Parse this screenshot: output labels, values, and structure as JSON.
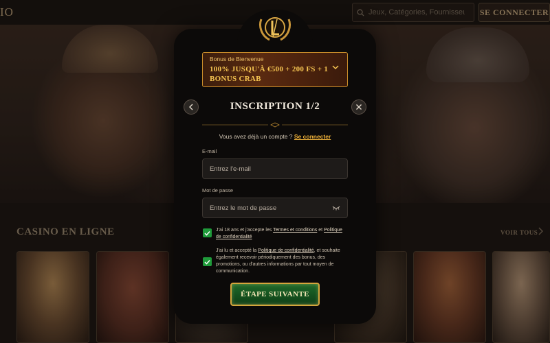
{
  "site": {
    "logo_text": "IO",
    "search": {
      "placeholder": "Jeux, Catégories, Fournisseurs"
    },
    "login_label": "SE CONNECTER",
    "section_title": "CASINO EN LIGNE",
    "see_all_label": "VOIR TOUS"
  },
  "modal": {
    "promo": {
      "label": "Bonus de Bienvenue",
      "offer": "100% JUSQU'À €500 + 200 FS + 1 BONUS CRAB"
    },
    "title": "INSCRIPTION 1/2",
    "have_account_text": "Vous avez déjà un compte ?",
    "login_link": "Se connecter",
    "email": {
      "label": "E-mail",
      "placeholder": "Entrez l'e-mail"
    },
    "password": {
      "label": "Mot de passe",
      "placeholder": "Entrez le mot de passe"
    },
    "consent_age": {
      "checked": true,
      "prefix": "J'ai 18 ans et j'accepte les",
      "terms_link": "Termes et conditions",
      "and": "et",
      "privacy_link": "Politique de confidentialité"
    },
    "consent_marketing": {
      "checked": true,
      "prefix": "J'ai lu et accepté la",
      "privacy_link": "Politique de confidentialité",
      "suffix": ", et souhaite également recevoir périodiquement des bonus, des promotions, ou d'autres informations par tout moyen de communication."
    },
    "next_button": "ÉTAPE SUIVANTE"
  },
  "colors": {
    "accent_gold": "#f0b23a",
    "checkbox_green": "#1f9a3a",
    "button_green": "#1f6a2a",
    "modal_bg": "#0c0a09"
  },
  "icons": [
    "search-icon",
    "chevron-down-icon",
    "chevron-left-icon",
    "close-icon",
    "eye-closed-icon",
    "check-icon",
    "chevron-right-icon",
    "crest-logo-icon"
  ]
}
